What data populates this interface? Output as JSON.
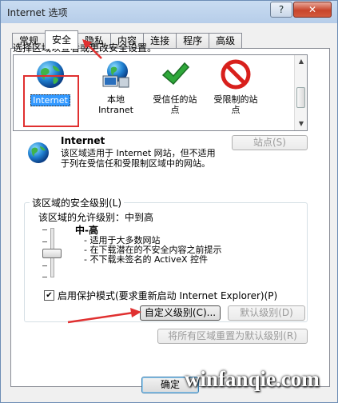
{
  "window": {
    "title": "Internet 选项",
    "help_symbol": "?",
    "close_symbol": "✕"
  },
  "tabs": [
    {
      "label": "常规",
      "active": false
    },
    {
      "label": "安全",
      "active": true
    },
    {
      "label": "隐私",
      "active": false
    },
    {
      "label": "内容",
      "active": false
    },
    {
      "label": "连接",
      "active": false
    },
    {
      "label": "程序",
      "active": false
    },
    {
      "label": "高级",
      "active": false
    }
  ],
  "zone_prompt": "选择区域以查看或更改安全设置。",
  "zones": [
    {
      "name": "Internet",
      "icon": "globe-icon",
      "selected": true
    },
    {
      "name": "本地\nIntranet",
      "icon": "local-intranet-icon",
      "selected": false
    },
    {
      "name": "受信任的站\n点",
      "icon": "check-icon",
      "selected": false
    },
    {
      "name": "受限制的站\n点",
      "icon": "restricted-icon",
      "selected": false
    }
  ],
  "zone_detail": {
    "title": "Internet",
    "description": "该区域适用于 Internet 网站，但不适用于列在受信任和受限制区域中的网站。",
    "sites_button": "站点(S)"
  },
  "security_level": {
    "group_title": "该区域的安全级别(L)",
    "allowed_levels": "该区域的允许级别：中到高",
    "level_name": "中-高",
    "bullets": [
      "- 适用于大多数网站",
      "- 在下载潜在的不安全内容之前提示",
      "- 不下载未签名的 ActiveX 控件"
    ]
  },
  "protected_mode": {
    "label": "启用保护模式(要求重新启动 Internet Explorer)(P)",
    "checked": true
  },
  "buttons": {
    "custom_level": "自定义级别(C)...",
    "default_level": "默认级别(D)",
    "reset_all": "将所有区域重置为默认级别(R)",
    "ok": "确定"
  },
  "watermark": "winfanqie.com",
  "colors": {
    "highlight": "#e03030",
    "selection": "#3399ff"
  }
}
